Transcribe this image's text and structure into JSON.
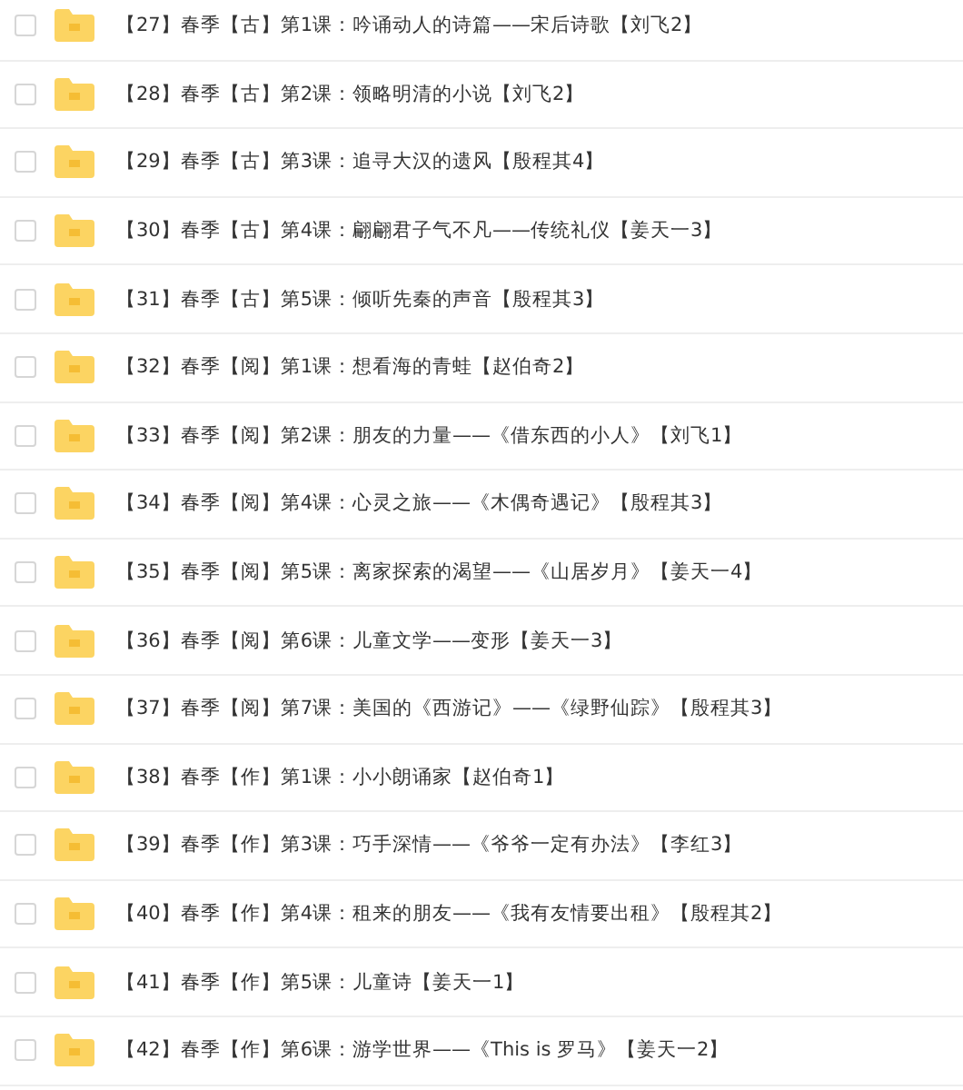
{
  "files": [
    {
      "name": "【27】春季【古】第1课：吟诵动人的诗篇——宋后诗歌【刘飞2】",
      "checked": false
    },
    {
      "name": "【28】春季【古】第2课：领略明清的小说【刘飞2】",
      "checked": false
    },
    {
      "name": "【29】春季【古】第3课：追寻大汉的遗风【殷程其4】",
      "checked": false
    },
    {
      "name": "【30】春季【古】第4课：翩翩君子气不凡——传统礼仪【姜天一3】",
      "checked": false
    },
    {
      "name": "【31】春季【古】第5课：倾听先秦的声音【殷程其3】",
      "checked": false
    },
    {
      "name": "【32】春季【阅】第1课：想看海的青蛙【赵伯奇2】",
      "checked": false
    },
    {
      "name": "【33】春季【阅】第2课：朋友的力量——《借东西的小人》【刘飞1】",
      "checked": false
    },
    {
      "name": "【34】春季【阅】第4课：心灵之旅——《木偶奇遇记》【殷程其3】",
      "checked": false
    },
    {
      "name": "【35】春季【阅】第5课：离家探索的渴望——《山居岁月》【姜天一4】",
      "checked": false
    },
    {
      "name": "【36】春季【阅】第6课：儿童文学——变形【姜天一3】",
      "checked": false
    },
    {
      "name": "【37】春季【阅】第7课：美国的《西游记》——《绿野仙踪》【殷程其3】",
      "checked": false
    },
    {
      "name": "【38】春季【作】第1课：小小朗诵家【赵伯奇1】",
      "checked": false
    },
    {
      "name": "【39】春季【作】第3课：巧手深情——《爷爷一定有办法》【李红3】",
      "checked": false
    },
    {
      "name": "【40】春季【作】第4课：租来的朋友——《我有友情要出租》【殷程其2】",
      "checked": false
    },
    {
      "name": "【41】春季【作】第5课：儿童诗【姜天一1】",
      "checked": false
    },
    {
      "name": "【42】春季【作】第6课：游学世界——《This is 罗马》【姜天一2】",
      "checked": false
    }
  ]
}
